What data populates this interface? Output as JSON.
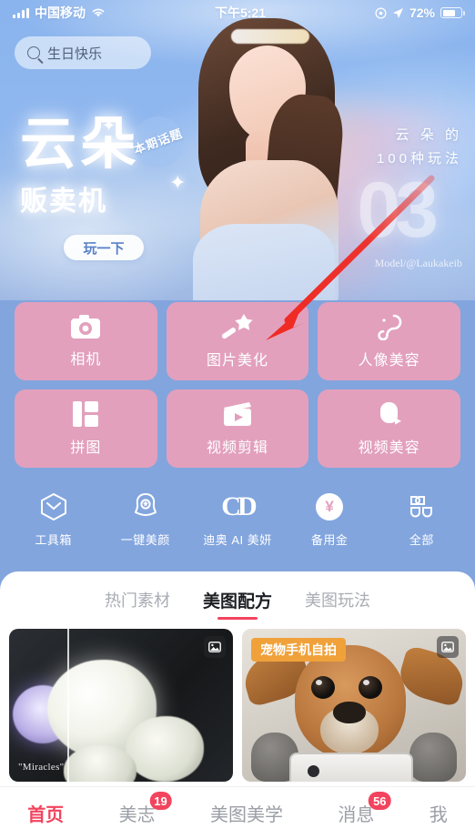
{
  "status_bar": {
    "carrier": "中国移动",
    "time": "下午5:21",
    "battery_percent": "72%",
    "signal_icon": "signal-bars-icon",
    "wifi_icon": "wifi-icon",
    "alarm_icon": "alarm-icon",
    "location_icon": "location-arrow-icon",
    "battery_icon": "battery-icon"
  },
  "search": {
    "value": "生日快乐",
    "icon": "search-icon"
  },
  "hero": {
    "title_line1": "云朵",
    "title_line2": "贩卖机",
    "badge": "本期话题",
    "cta": "玩一下",
    "right_line1": "云 朵 的",
    "right_line2": "100种玩法",
    "watermark": "Model/@Laukakeib",
    "number": "03"
  },
  "tiles": [
    {
      "label": "相机",
      "icon": "camera-icon"
    },
    {
      "label": "图片美化",
      "icon": "magic-wand-icon"
    },
    {
      "label": "人像美容",
      "icon": "portrait-beauty-icon"
    },
    {
      "label": "拼图",
      "icon": "collage-icon"
    },
    {
      "label": "视频剪辑",
      "icon": "video-clapper-icon"
    },
    {
      "label": "视频美容",
      "icon": "video-beauty-icon"
    }
  ],
  "shortcuts": [
    {
      "label": "工具箱",
      "icon": "toolbox-icon"
    },
    {
      "label": "一键美颜",
      "icon": "one-tap-beauty-icon"
    },
    {
      "label": "迪奥 AI 美妍",
      "icon": "dior-cd-logo-icon"
    },
    {
      "label": "备用金",
      "icon": "yen-coin-icon"
    },
    {
      "label": "全部",
      "icon": "grid-all-icon"
    }
  ],
  "tabs": [
    {
      "label": "热门素材",
      "active": false
    },
    {
      "label": "美图配方",
      "active": true
    },
    {
      "label": "美图玩法",
      "active": false
    }
  ],
  "cards": [
    {
      "caption": "\"Miracles\"",
      "badge_icon": "image-icon",
      "ribbon": ""
    },
    {
      "caption": "",
      "badge_icon": "image-icon",
      "ribbon": "宠物手机自拍"
    }
  ],
  "bottom_nav": [
    {
      "label": "首页",
      "badge": "",
      "active": true
    },
    {
      "label": "美志",
      "badge": "19",
      "active": false
    },
    {
      "label": "美图美学",
      "badge": "",
      "active": false
    },
    {
      "label": "消息",
      "badge": "56",
      "active": false
    },
    {
      "label": "我",
      "badge": "",
      "active": false
    }
  ],
  "annotation": {
    "arrow_color": "#ef2b24",
    "target": "图片美化"
  },
  "colors": {
    "tile_pink": "#e2a0bd",
    "bg_blue": "#82a5de",
    "accent_red": "#f2445e",
    "ribbon_orange": "#f0a13a"
  }
}
